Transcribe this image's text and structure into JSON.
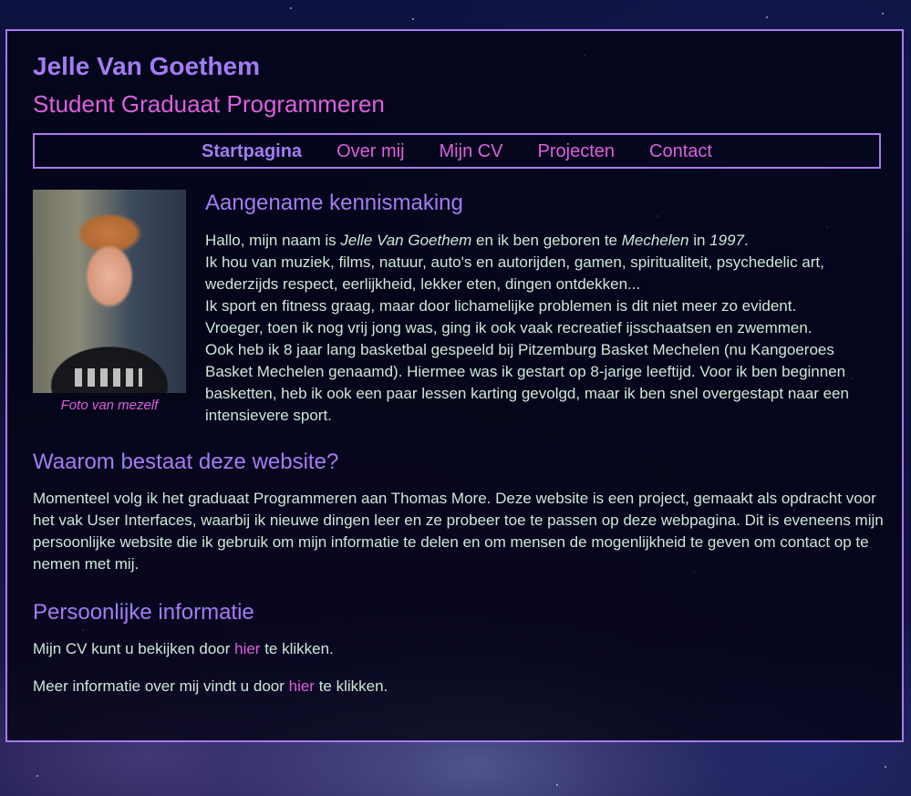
{
  "header": {
    "name": "Jelle Van Goethem",
    "subtitle": "Student Graduaat Programmeren"
  },
  "nav": {
    "items": [
      {
        "label": "Startpagina",
        "active": true
      },
      {
        "label": "Over mij",
        "active": false
      },
      {
        "label": "Mijn CV",
        "active": false
      },
      {
        "label": "Projecten",
        "active": false
      },
      {
        "label": "Contact",
        "active": false
      }
    ]
  },
  "photo": {
    "caption": "Foto van mezelf"
  },
  "intro": {
    "heading": "Aangename kennismaking",
    "p1_a": "Hallo, mijn naam is ",
    "p1_name": "Jelle Van Goethem",
    "p1_b": " en ik ben geboren te ",
    "p1_city": "Mechelen",
    "p1_c": " in ",
    "p1_year": "1997",
    "p1_d": ".",
    "p2": "Ik hou van muziek, films, natuur, auto's en autorijden, gamen, spiritualiteit, psychedelic art, wederzijds respect, eerlijkheid, lekker eten, dingen ontdekken...",
    "p3": "Ik sport en fitness graag, maar door lichamelijke problemen is dit niet meer zo evident.",
    "p4": "Vroeger, toen ik nog vrij jong was, ging ik ook vaak recreatief ijsschaatsen en zwemmen.",
    "p5": "Ook heb ik 8 jaar lang basketbal gespeeld bij Pitzemburg Basket Mechelen (nu Kangoeroes Basket Mechelen genaamd). Hiermee was ik gestart op 8-jarige leeftijd. Voor ik ben beginnen basketten, heb ik ook een paar lessen karting gevolgd, maar ik ben snel overgestapt naar een intensievere sport."
  },
  "why": {
    "heading": "Waarom bestaat deze website?",
    "text": "Momenteel volg ik het graduaat Programmeren aan Thomas More. Deze website is een project, gemaakt als opdracht voor het vak User Interfaces, waarbij ik nieuwe dingen leer en ze probeer toe te passen op deze webpagina. Dit is eveneens mijn persoonlijke website die ik gebruik om mijn informatie te delen en om mensen de mogenlijkheid te geven om contact op te nemen met mij."
  },
  "personal": {
    "heading": "Persoonlijke informatie",
    "cv_a": "Mijn CV kunt u bekijken door ",
    "cv_link": "hier",
    "cv_b": " te klikken.",
    "info_a": "Meer informatie over mij vindt u door ",
    "info_link": "hier",
    "info_b": " te klikken."
  },
  "colors": {
    "accent_purple": "#a37cf2",
    "accent_pink": "#de5fdc",
    "text": "#cfe7d6",
    "border": "#a77bf0"
  }
}
